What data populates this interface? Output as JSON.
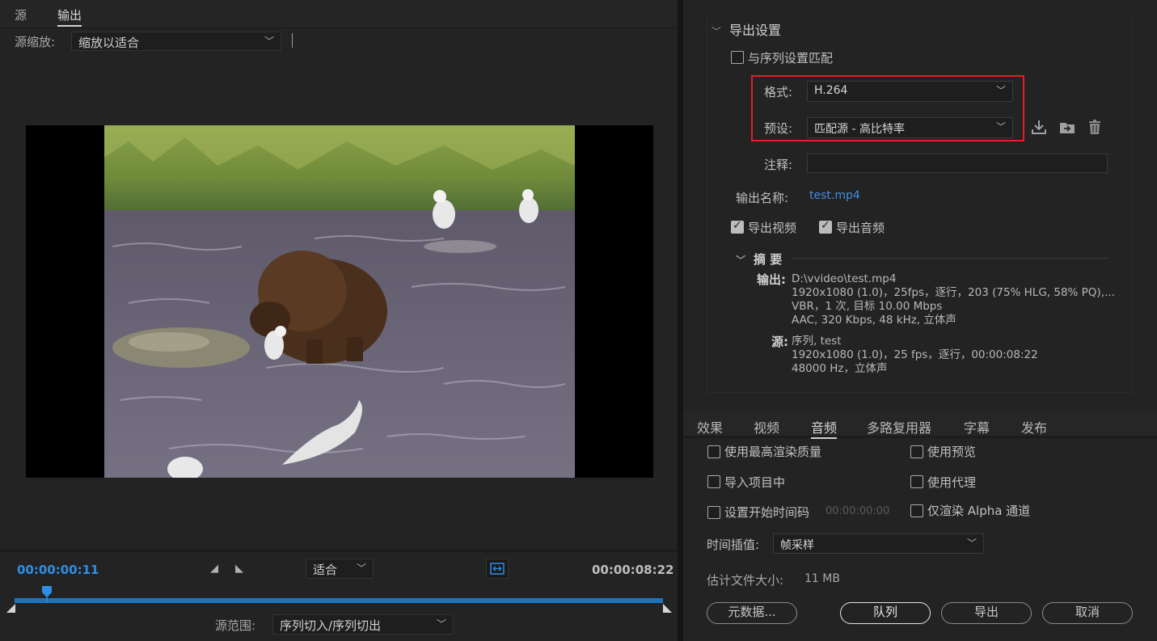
{
  "left_panel": {
    "tabs": [
      {
        "label": "源"
      },
      {
        "label": "输出",
        "active": true
      }
    ],
    "source_scaling": {
      "label": "源缩放:",
      "value": "缩放以适合"
    },
    "timecode_current": "00:00:00:11",
    "timecode_end": "00:00:08:22",
    "fit_select": "适合",
    "playhead_position": 0.05,
    "source_range": {
      "label": "源范围:",
      "value": "序列切入/序列切出"
    }
  },
  "export_settings": {
    "header": "导出设置",
    "match_sequence": {
      "label": "与序列设置匹配",
      "checked": false
    },
    "format": {
      "label": "格式:",
      "value": "H.264"
    },
    "preset": {
      "label": "预设:",
      "value": "匹配源 - 高比特率"
    },
    "comments": {
      "label": "注释:",
      "value": ""
    },
    "output_name": {
      "label": "输出名称:",
      "value": "test.mp4"
    },
    "export_video": {
      "label": "导出视频",
      "checked": true
    },
    "export_audio": {
      "label": "导出音频",
      "checked": true
    },
    "summary": {
      "header": "摘 要",
      "output_key": "输出:",
      "output_lines": [
        "D:\\vvideo\\test.mp4",
        "1920x1080 (1.0)，25fps，逐行，203 (75% HLG, 58% PQ),...",
        "VBR，1 次, 目标 10.00 Mbps",
        "AAC, 320 Kbps, 48  kHz, 立体声"
      ],
      "source_key": "源:",
      "source_lines": [
        "序列, test",
        "1920x1080 (1.0)，25 fps，逐行，00:00:08:22",
        "48000 Hz，立体声"
      ]
    }
  },
  "tabs": [
    {
      "label": "效果"
    },
    {
      "label": "视频"
    },
    {
      "label": "音频",
      "active": true
    },
    {
      "label": "多路复用器"
    },
    {
      "label": "字幕"
    },
    {
      "label": "发布"
    }
  ],
  "options": {
    "max_render_quality": {
      "label": "使用最高渲染质量",
      "checked": false
    },
    "use_previews": {
      "label": "使用预览",
      "checked": false
    },
    "import_into_project": {
      "label": "导入项目中",
      "checked": false
    },
    "use_proxies": {
      "label": "使用代理",
      "checked": false
    },
    "set_start_timecode": {
      "label": "设置开始时间码",
      "checked": false,
      "value": "00:00:00:00"
    },
    "render_alpha_only": {
      "label": "仅渲染 Alpha 通道",
      "checked": false
    },
    "time_interpolation": {
      "label": "时间插值:",
      "value": "帧采样"
    },
    "estimated_file_size": {
      "label": "估计文件大小:",
      "value": "11 MB"
    }
  },
  "buttons": {
    "metadata": "元数据...",
    "queue": "队列",
    "export": "导出",
    "cancel": "取消"
  },
  "colors": {
    "accent_blue": "#2f8ee3",
    "timeline_blue": "#1d74be",
    "highlight_red": "#e0202a"
  }
}
